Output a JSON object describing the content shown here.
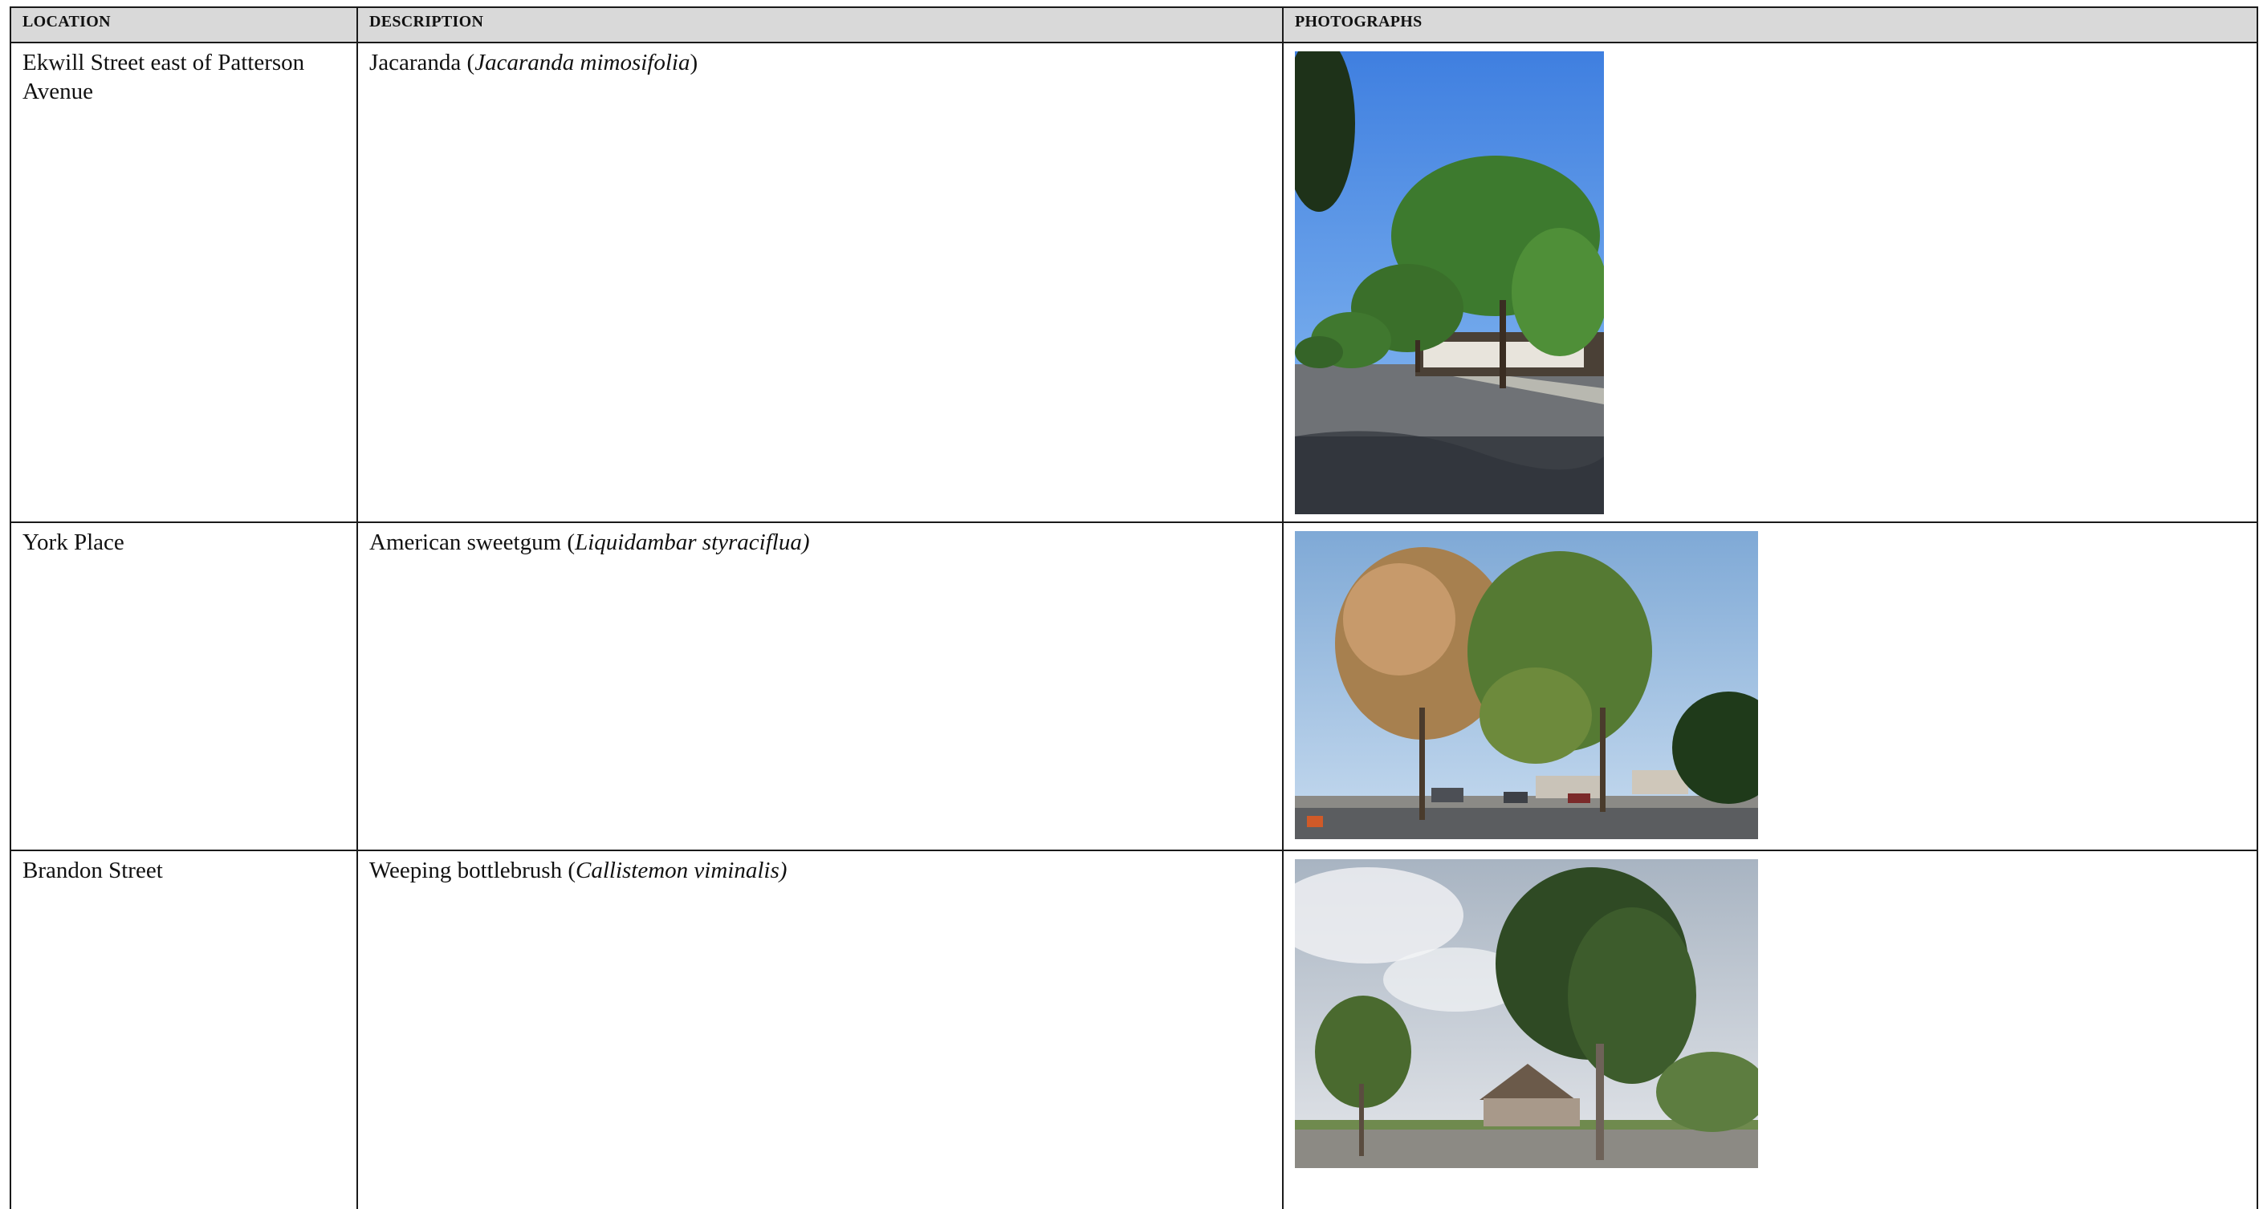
{
  "headers": {
    "location": "LOCATION",
    "description": "DESCRIPTION",
    "photographs": "PHOTOGRAPHS"
  },
  "rows": [
    {
      "location": "Ekwill Street east of Patterson Avenue",
      "common_name": "Jacaranda (",
      "scientific_name": "Jacaranda mimosifolia",
      "closing": ")",
      "photo_icon": "street-trees-photo"
    },
    {
      "location": "York Place",
      "common_name": "American sweetgum (",
      "scientific_name": "Liquidambar styraciflua)",
      "closing": "",
      "photo_icon": "street-trees-photo"
    },
    {
      "location": "Brandon Street",
      "common_name": "Weeping bottlebrush (",
      "scientific_name": "Callistemon viminalis)",
      "closing": "",
      "photo_icon": "street-trees-photo"
    }
  ]
}
